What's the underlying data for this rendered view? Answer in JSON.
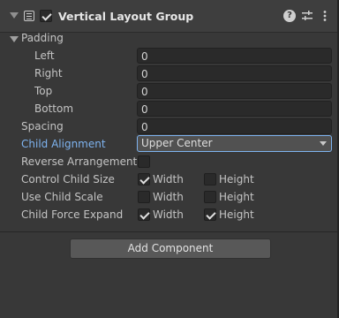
{
  "component": {
    "title": "Vertical Layout Group",
    "enabled": true,
    "icons": [
      "component-icon",
      "help-icon",
      "presets-icon",
      "more-options-icon"
    ]
  },
  "padding": {
    "label": "Padding",
    "left_label": "Left",
    "left_value": "0",
    "right_label": "Right",
    "right_value": "0",
    "top_label": "Top",
    "top_value": "0",
    "bottom_label": "Bottom",
    "bottom_value": "0"
  },
  "spacing": {
    "label": "Spacing",
    "value": "0"
  },
  "child_alignment": {
    "label": "Child Alignment",
    "value": "Upper Center"
  },
  "reverse_arrangement": {
    "label": "Reverse Arrangement",
    "checked": false
  },
  "control_child_size": {
    "label": "Control Child Size",
    "width_label": "Width",
    "width": true,
    "height_label": "Height",
    "height": false
  },
  "use_child_scale": {
    "label": "Use Child Scale",
    "width_label": "Width",
    "width": false,
    "height_label": "Height",
    "height": false
  },
  "child_force_expand": {
    "label": "Child Force Expand",
    "width_label": "Width",
    "width": true,
    "height_label": "Height",
    "height": true
  },
  "add_component": {
    "label": "Add Component"
  },
  "colors": {
    "background": "#383838",
    "header": "#3e3e3e",
    "field": "#2a2a2a",
    "highlight": "#7eb3ef"
  }
}
